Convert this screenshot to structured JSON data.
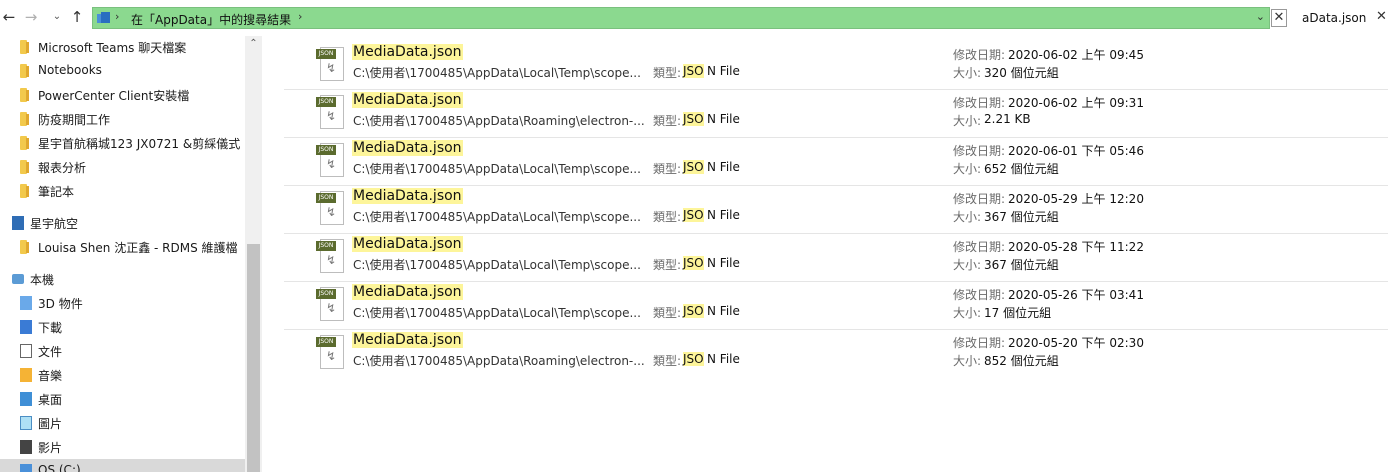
{
  "nav_buttons": {
    "back": "←",
    "forward": "→",
    "recent": "⌄",
    "up": "↑"
  },
  "address": {
    "text": "在「AppData」中的搜尋結果",
    "sep": "›",
    "dropdown": "⌄",
    "close": "✕"
  },
  "search": {
    "value": "aData.json",
    "clear": "✕"
  },
  "sidebar": {
    "items": [
      {
        "label": "Microsoft Teams 聊天檔案",
        "icon": "folder-icon"
      },
      {
        "label": "Notebooks",
        "icon": "folder-icon"
      },
      {
        "label": "PowerCenter Client安裝檔",
        "icon": "folder-icon"
      },
      {
        "label": "防疫期間工作",
        "icon": "folder-icon"
      },
      {
        "label": "星宇首航稱城123 JX0721 &剪綵儀式",
        "icon": "folder-icon"
      },
      {
        "label": "報表分析",
        "icon": "folder-icon"
      },
      {
        "label": "筆記本",
        "icon": "folder-icon"
      },
      {
        "label": "星宇航空",
        "icon": "building-icon"
      },
      {
        "label": "Louisa Shen 沈正鑫 - RDMS 維護檔",
        "icon": "folder-icon"
      },
      {
        "label": "本機",
        "icon": "computer-icon"
      },
      {
        "label": "3D 物件",
        "icon": "3d-objects-icon"
      },
      {
        "label": "下載",
        "icon": "downloads-icon"
      },
      {
        "label": "文件",
        "icon": "documents-icon"
      },
      {
        "label": "音樂",
        "icon": "music-icon"
      },
      {
        "label": "桌面",
        "icon": "desktop-icon"
      },
      {
        "label": "圖片",
        "icon": "pictures-icon"
      },
      {
        "label": "影片",
        "icon": "videos-icon"
      },
      {
        "label": "OS (C:)",
        "icon": "drive-icon"
      }
    ],
    "scroll_up": "⌃"
  },
  "results": {
    "type_label": "類型:",
    "type_highlight": "JSO",
    "type_rest": "N File",
    "date_label": "修改日期:",
    "size_label": "大小:",
    "icon_tag": "JSON",
    "items": [
      {
        "name": "MediaData.json",
        "path": "C:\\使用者\\1700485\\AppData\\Local\\Temp\\scope...",
        "date": "2020-06-02 上午 09:45",
        "size": "320 個位元組"
      },
      {
        "name": "MediaData.json",
        "path": "C:\\使用者\\1700485\\AppData\\Roaming\\electron-...",
        "date": "2020-06-02 上午 09:31",
        "size": "2.21 KB"
      },
      {
        "name": "MediaData.json",
        "path": "C:\\使用者\\1700485\\AppData\\Local\\Temp\\scope...",
        "date": "2020-06-01 下午 05:46",
        "size": "652 個位元組"
      },
      {
        "name": "MediaData.json",
        "path": "C:\\使用者\\1700485\\AppData\\Local\\Temp\\scope...",
        "date": "2020-05-29 上午 12:20",
        "size": "367 個位元組"
      },
      {
        "name": "MediaData.json",
        "path": "C:\\使用者\\1700485\\AppData\\Local\\Temp\\scope...",
        "date": "2020-05-28 下午 11:22",
        "size": "367 個位元組"
      },
      {
        "name": "MediaData.json",
        "path": "C:\\使用者\\1700485\\AppData\\Local\\Temp\\scope...",
        "date": "2020-05-26 下午 03:41",
        "size": "17 個位元組"
      },
      {
        "name": "MediaData.json",
        "path": "C:\\使用者\\1700485\\AppData\\Roaming\\electron-...",
        "date": "2020-05-20 下午 02:30",
        "size": "852 個位元組"
      }
    ]
  },
  "colors": {
    "address_bar": "#8bd98f",
    "highlight": "#fdf59a",
    "selection": "#d9d9d9"
  }
}
